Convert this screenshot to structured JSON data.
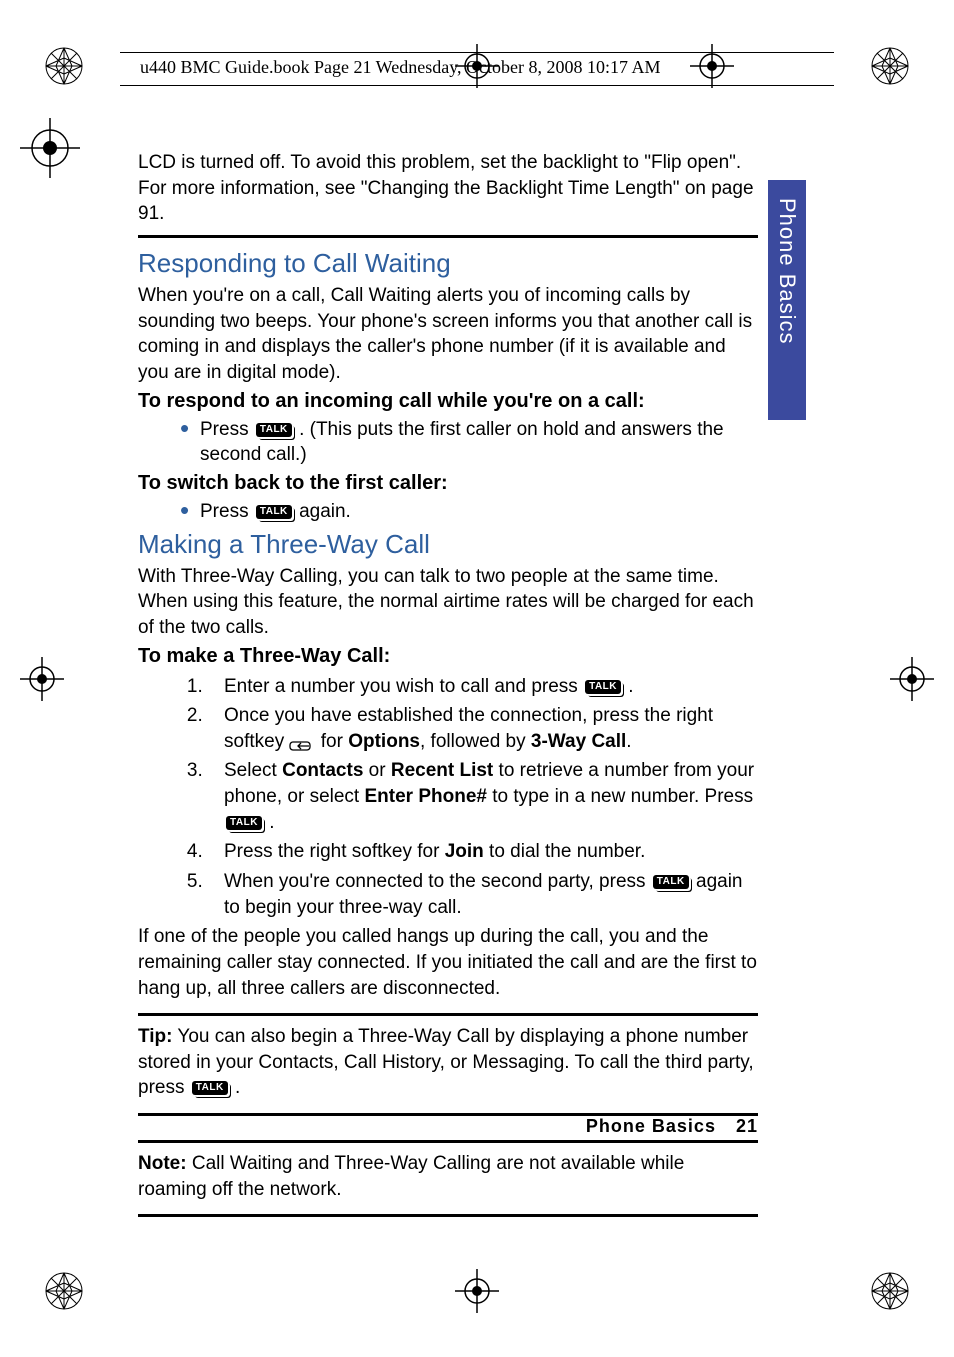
{
  "header": {
    "runningHead": "u440 BMC Guide.book  Page 21  Wednesday, October 8, 2008  10:17 AM"
  },
  "sideTab": "Phone Basics",
  "intro": {
    "text": "LCD is turned off. To avoid this problem, set the backlight to \"Flip open\". For more information, see \"Changing the Backlight Time Length\" on page 91."
  },
  "s1": {
    "title": "Responding to Call Waiting",
    "body": "When you're on a call, Call Waiting alerts you of incoming calls by sounding two beeps. Your phone's screen informs you that another call is coming in and displays the caller's phone number (if it is available and you are in digital mode).",
    "sub1": "To respond to an incoming call while you're on a call:",
    "b1_pre": "Press ",
    "b1_post": ". (This puts the first caller on hold and answers the second call.)",
    "sub2": "To switch back to the first caller:",
    "b2_pre": "Press ",
    "b2_post": " again."
  },
  "s2": {
    "title": "Making a Three-Way Call",
    "body": "With Three-Way Calling, you can talk to two people at the same time. When using this feature, the normal airtime rates will be charged for each of the two calls.",
    "sub": "To make a Three-Way Call:",
    "step1_pre": "Enter a number you wish to call and press ",
    "step1_post": ".",
    "step2_pre": "Once you have established the connection, press the right softkey ",
    "step2_mid": " for ",
    "step2_b1": "Options",
    "step2_mid2": ", followed by ",
    "step2_b2": "3-Way Call",
    "step2_post": ".",
    "step3_pre": "Select ",
    "step3_b1": "Contacts",
    "step3_mid1": " or ",
    "step3_b2": "Recent List",
    "step3_mid2": " to retrieve a number from your phone, or select ",
    "step3_b3": "Enter Phone#",
    "step3_mid3": " to type in a new number. Press ",
    "step3_post": ".",
    "step4_pre": "Press the right softkey for ",
    "step4_b": "Join",
    "step4_post": " to dial the number.",
    "step5_pre": "When you're connected to the second party, press ",
    "step5_post": " again to begin your three-way call.",
    "tail": "If one of the people you called hangs up during the call, you and the remaining caller stay connected. If you initiated the call and are the first to hang up, all three callers are disconnected."
  },
  "tip": {
    "label": "Tip:",
    "pre": " You can also begin a Three-Way Call by displaying a phone number stored in your Contacts, Call History, or Messaging. To call the third party, press ",
    "post": "."
  },
  "note": {
    "label": "Note:",
    "text": " Call Waiting and Three-Way Calling are not available while roaming off the network."
  },
  "key": {
    "talk": "TALK"
  },
  "footer": {
    "section": "Phone Basics",
    "page": "21"
  }
}
